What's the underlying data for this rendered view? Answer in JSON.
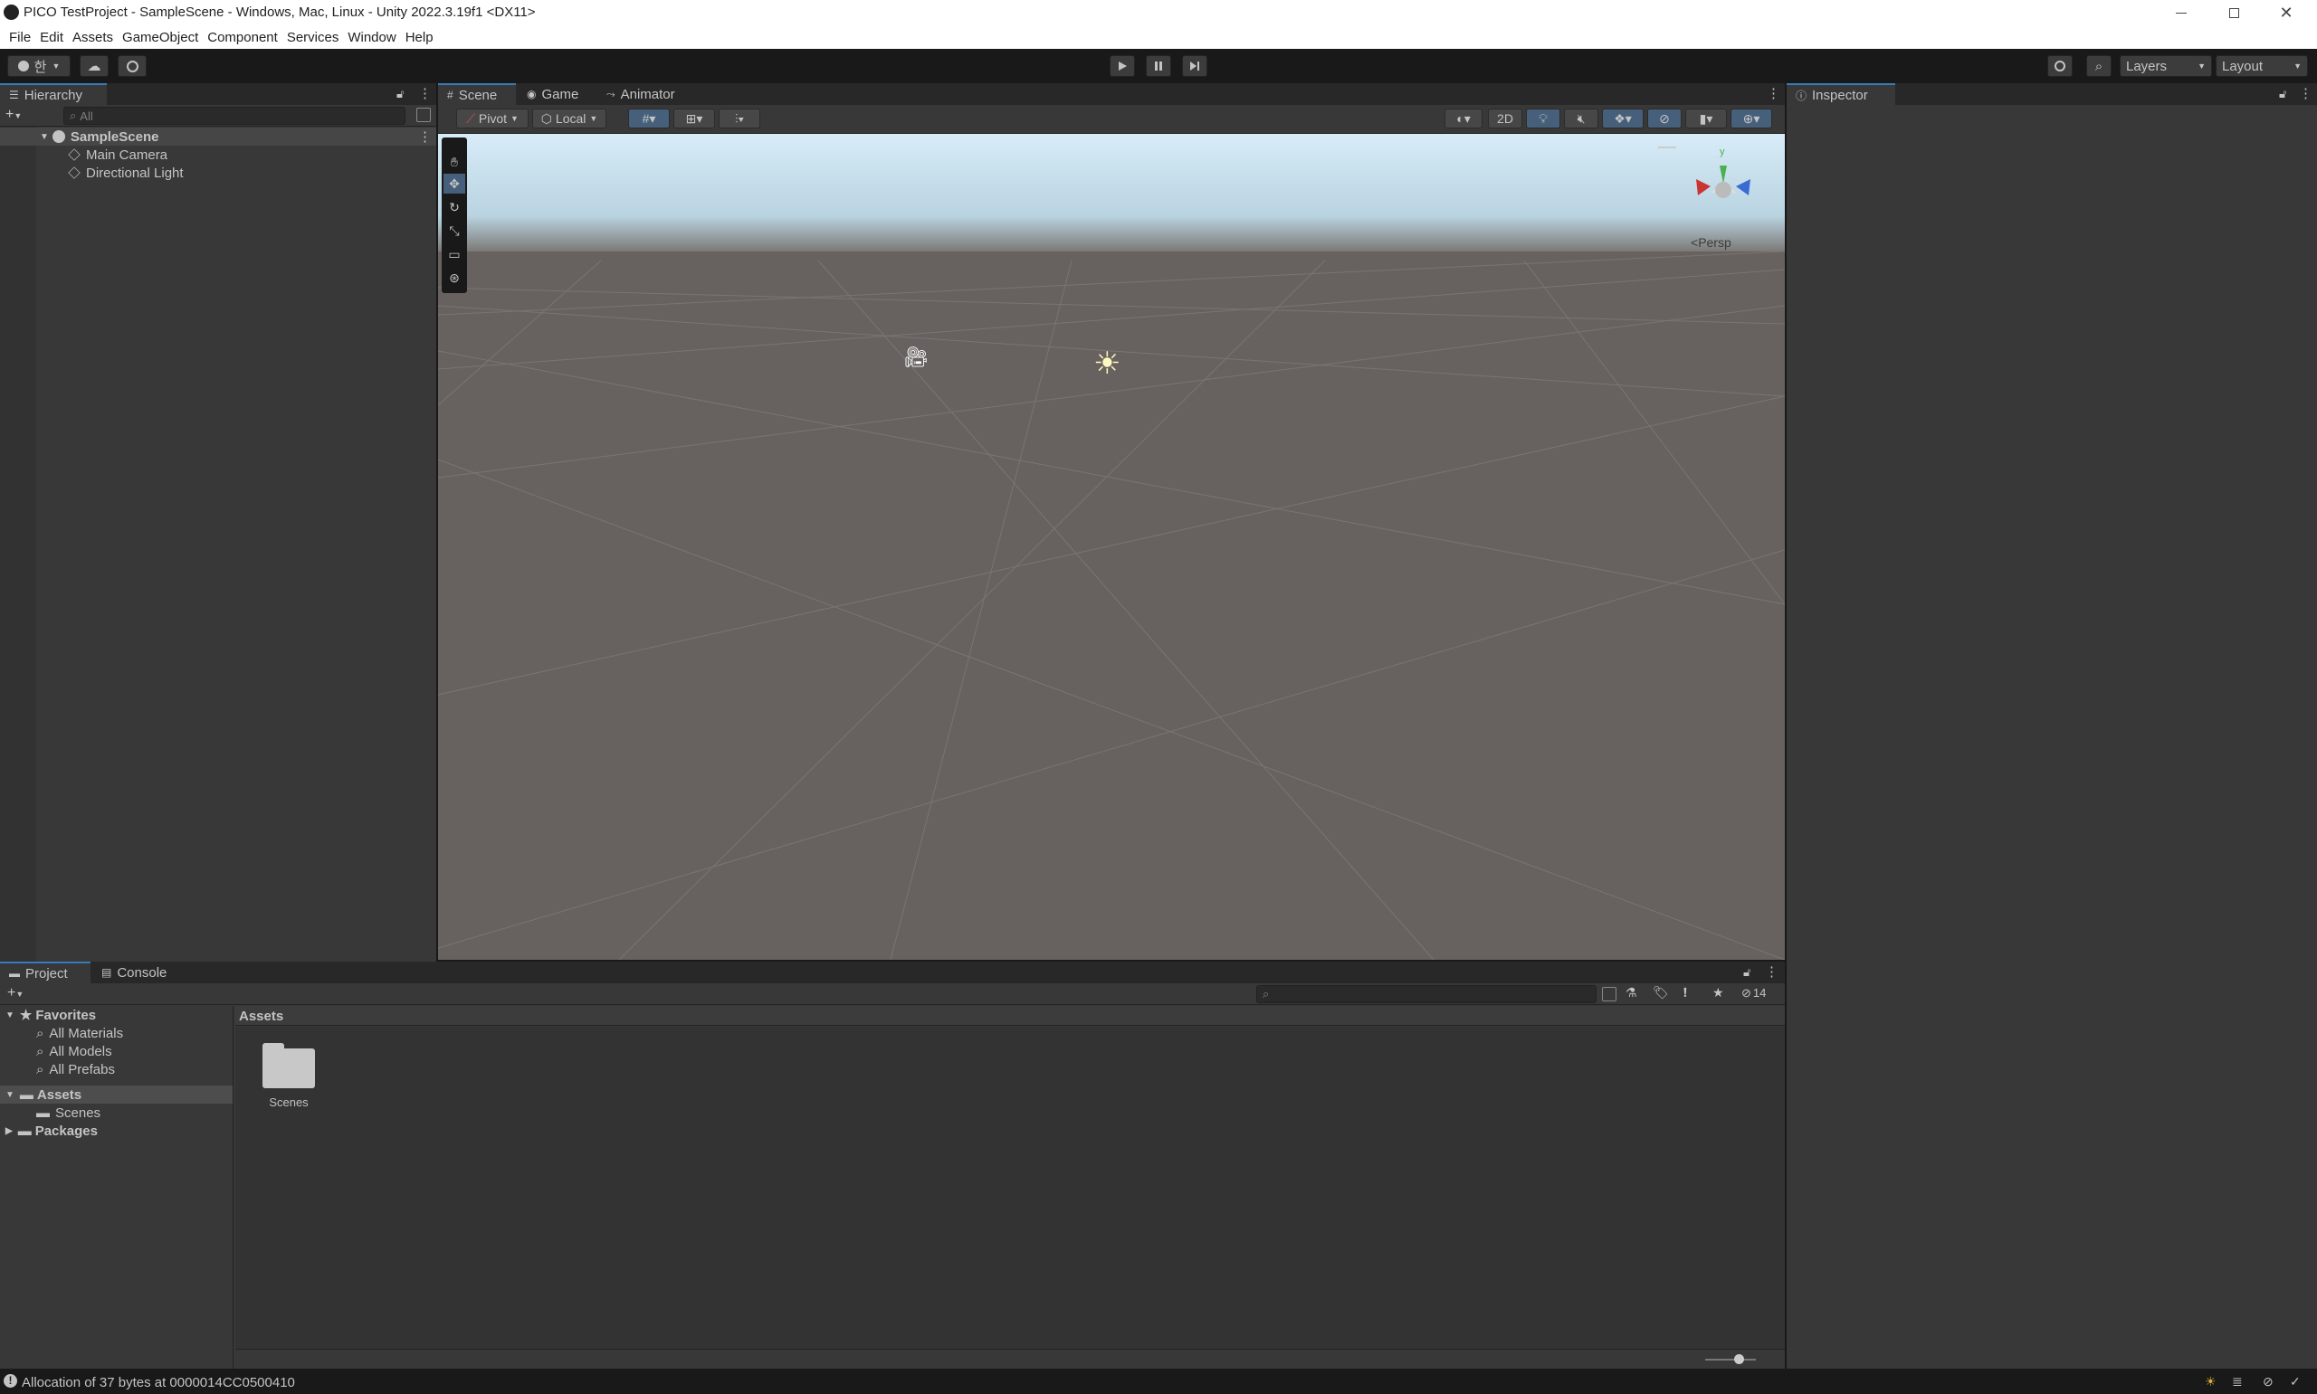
{
  "window": {
    "title": "PICO TestProject - SampleScene - Windows, Mac, Linux - Unity 2022.3.19f1 <DX11>",
    "controls": [
      "minimize",
      "restore",
      "close"
    ]
  },
  "menu": [
    "File",
    "Edit",
    "Assets",
    "GameObject",
    "Component",
    "Services",
    "Window",
    "Help"
  ],
  "toolbar": {
    "account_label": "한",
    "layers_label": "Layers",
    "layout_label": "Layout"
  },
  "hierarchy": {
    "tab": "Hierarchy",
    "search_placeholder": "All",
    "scene": "SampleScene",
    "items": [
      "Main Camera",
      "Directional Light"
    ]
  },
  "scene_view": {
    "tabs": [
      "Scene",
      "Game",
      "Animator"
    ],
    "pivot": "Pivot",
    "local": "Local",
    "mode_2d": "2D",
    "persp": "Persp",
    "gizmo_y": "y"
  },
  "inspector": {
    "tab": "Inspector"
  },
  "project": {
    "tabs": [
      "Project",
      "Console"
    ],
    "favorites_label": "Favorites",
    "favorites": [
      "All Materials",
      "All Models",
      "All Prefabs"
    ],
    "assets_label": "Assets",
    "assets_children": [
      "Scenes"
    ],
    "packages_label": "Packages",
    "breadcrumb": "Assets",
    "grid_items": [
      "Scenes"
    ],
    "hidden_count": "14"
  },
  "status": {
    "message": "Allocation of 37 bytes at 0000014CC0500410"
  },
  "colors": {
    "accent": "#3a79bb",
    "panel": "#383838",
    "dark": "#282828",
    "sky": "#cfe6f5",
    "ground": "#676260"
  }
}
